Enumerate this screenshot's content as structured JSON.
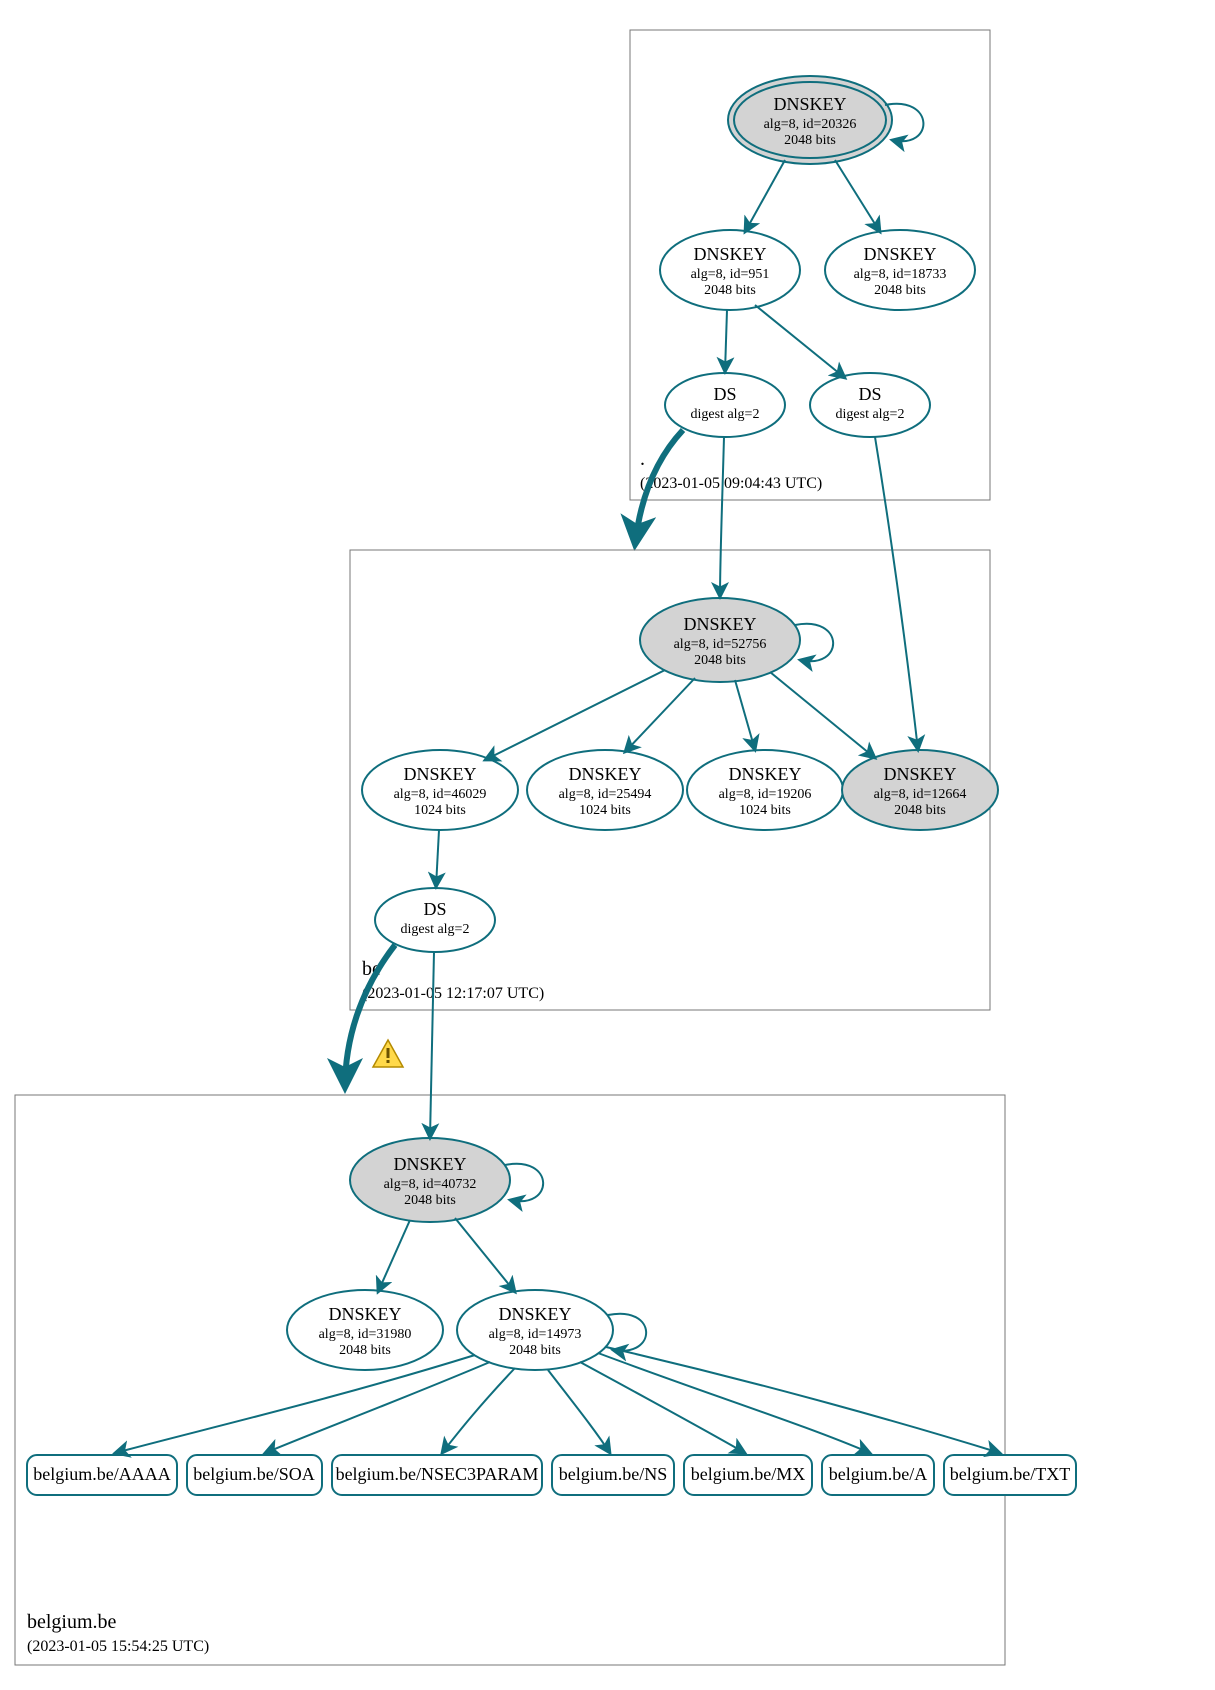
{
  "zones": {
    "root": {
      "name": ".",
      "timestamp": "(2023-01-05 09:04:43 UTC)"
    },
    "be": {
      "name": "be",
      "timestamp": "(2023-01-05 12:17:07 UTC)"
    },
    "leaf": {
      "name": "belgium.be",
      "timestamp": "(2023-01-05 15:54:25 UTC)"
    }
  },
  "nodes": {
    "root_ksk": {
      "title": "DNSKEY",
      "sub1": "alg=8, id=20326",
      "sub2": "2048 bits"
    },
    "root_zsk_a": {
      "title": "DNSKEY",
      "sub1": "alg=8, id=951",
      "sub2": "2048 bits"
    },
    "root_zsk_b": {
      "title": "DNSKEY",
      "sub1": "alg=8, id=18733",
      "sub2": "2048 bits"
    },
    "root_ds_a": {
      "title": "DS",
      "sub1": "digest alg=2"
    },
    "root_ds_b": {
      "title": "DS",
      "sub1": "digest alg=2"
    },
    "be_ksk": {
      "title": "DNSKEY",
      "sub1": "alg=8, id=52756",
      "sub2": "2048 bits"
    },
    "be_zsk_1": {
      "title": "DNSKEY",
      "sub1": "alg=8, id=46029",
      "sub2": "1024 bits"
    },
    "be_zsk_2": {
      "title": "DNSKEY",
      "sub1": "alg=8, id=25494",
      "sub2": "1024 bits"
    },
    "be_zsk_3": {
      "title": "DNSKEY",
      "sub1": "alg=8, id=19206",
      "sub2": "1024 bits"
    },
    "be_sep": {
      "title": "DNSKEY",
      "sub1": "alg=8, id=12664",
      "sub2": "2048 bits"
    },
    "be_ds": {
      "title": "DS",
      "sub1": "digest alg=2"
    },
    "leaf_ksk": {
      "title": "DNSKEY",
      "sub1": "alg=8, id=40732",
      "sub2": "2048 bits"
    },
    "leaf_zsk_a": {
      "title": "DNSKEY",
      "sub1": "alg=8, id=31980",
      "sub2": "2048 bits"
    },
    "leaf_zsk_b": {
      "title": "DNSKEY",
      "sub1": "alg=8, id=14973",
      "sub2": "2048 bits"
    }
  },
  "records": {
    "aaaa": "belgium.be/AAAA",
    "soa": "belgium.be/SOA",
    "nsec3": "belgium.be/NSEC3PARAM",
    "ns": "belgium.be/NS",
    "mx": "belgium.be/MX",
    "a": "belgium.be/A",
    "txt": "belgium.be/TXT"
  }
}
